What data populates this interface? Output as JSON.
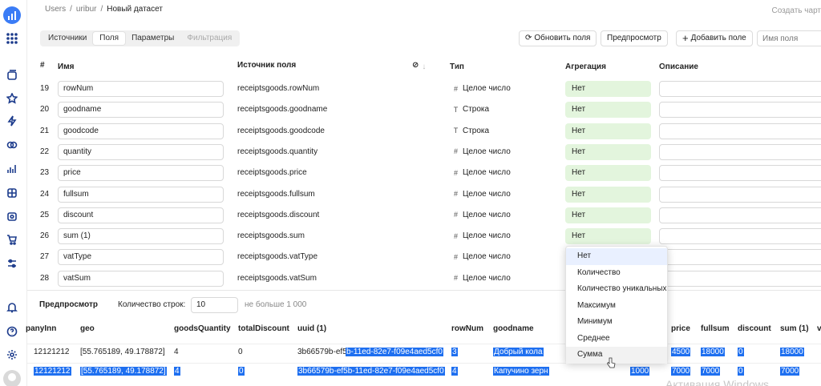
{
  "breadcrumb": {
    "items": [
      "Users",
      "uribur"
    ],
    "current": "Новый датасет",
    "sep": "/"
  },
  "header_action": "Создать чарт",
  "tabs": [
    {
      "label": "Источники",
      "state": "normal"
    },
    {
      "label": "Поля",
      "state": "active"
    },
    {
      "label": "Параметры",
      "state": "normal"
    },
    {
      "label": "Фильтрация",
      "state": "disabled"
    }
  ],
  "toolbar": {
    "refresh_label": "Обновить поля",
    "preview_label": "Предпросмотр",
    "add_label": "Добавить поле",
    "search_placeholder": "Имя поля"
  },
  "columns": {
    "num": "#",
    "name": "Имя",
    "source": "Источник поля",
    "type": "Тип",
    "aggregation": "Агрегация",
    "description": "Описание"
  },
  "fields": [
    {
      "num": "19",
      "name": "rowNum",
      "source": "receiptsgoods.rowNum",
      "type": "Целое число",
      "type_icon": "#",
      "agg": "Нет"
    },
    {
      "num": "20",
      "name": "goodname",
      "source": "receiptsgoods.goodname",
      "type": "Строка",
      "type_icon": "T",
      "agg": "Нет"
    },
    {
      "num": "21",
      "name": "goodcode",
      "source": "receiptsgoods.goodcode",
      "type": "Строка",
      "type_icon": "T",
      "agg": "Нет"
    },
    {
      "num": "22",
      "name": "quantity",
      "source": "receiptsgoods.quantity",
      "type": "Целое число",
      "type_icon": "#",
      "agg": "Нет"
    },
    {
      "num": "23",
      "name": "price",
      "source": "receiptsgoods.price",
      "type": "Целое число",
      "type_icon": "#",
      "agg": "Нет"
    },
    {
      "num": "24",
      "name": "fullsum",
      "source": "receiptsgoods.fullsum",
      "type": "Целое число",
      "type_icon": "#",
      "agg": "Нет"
    },
    {
      "num": "25",
      "name": "discount",
      "source": "receiptsgoods.discount",
      "type": "Целое число",
      "type_icon": "#",
      "agg": "Нет"
    },
    {
      "num": "26",
      "name": "sum (1)",
      "source": "receiptsgoods.sum",
      "type": "Целое число",
      "type_icon": "#",
      "agg": "Нет"
    },
    {
      "num": "27",
      "name": "vatType",
      "source": "receiptsgoods.vatType",
      "type": "Целое число",
      "type_icon": "#",
      "agg": ""
    },
    {
      "num": "28",
      "name": "vatSum",
      "source": "receiptsgoods.vatSum",
      "type": "Целое число",
      "type_icon": "#",
      "agg": ""
    }
  ],
  "aggregation_menu": [
    "Нет",
    "Количество",
    "Количество уникальных",
    "Максимум",
    "Минимум",
    "Среднее",
    "Сумма"
  ],
  "preview": {
    "title": "Предпросмотр",
    "rows_label": "Количество строк:",
    "rows_value": "10",
    "rows_limit": "не больше 1 000",
    "columns": [
      "panyInn",
      "geo",
      "goodsQuantity",
      "totalDiscount",
      "uuid (1)",
      "rowNum",
      "goodname",
      "price",
      "fullsum",
      "discount",
      "sum (1)",
      "v"
    ],
    "rows": [
      {
        "inn": "12121212",
        "geo": "[55.765189, 49.178872]",
        "gq": "4",
        "td": "0",
        "uuid_a": "3b66579b-ef5",
        "uuid_b": "b-11ed-82e7-f09e4aed5cf0",
        "rownum": "3",
        "goodname": "Добрый кола",
        "price": "4500",
        "fullsum": "18000",
        "discount": "0",
        "sum": "18000",
        "extra": ""
      },
      {
        "inn": "12121212",
        "geo": "[55.765189, 49.178872]",
        "gq": "4",
        "td": "0",
        "uuid_a": "",
        "uuid_b": "3b66579b-ef5b-11ed-82e7-f09e4aed5cf0",
        "rownum": "4",
        "goodname": "Капучино зерн",
        "price": "7000",
        "fullsum": "7000",
        "discount": "0",
        "sum": "7000",
        "extra": "1000"
      }
    ]
  },
  "watermark": "Активация Windows"
}
